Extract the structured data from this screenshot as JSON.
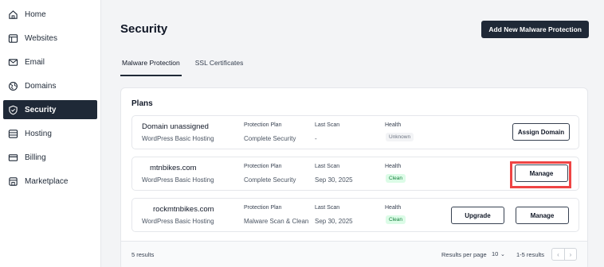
{
  "sidebar": {
    "items": [
      {
        "label": "Home",
        "icon": "home-icon"
      },
      {
        "label": "Websites",
        "icon": "browser-icon"
      },
      {
        "label": "Email",
        "icon": "mail-icon"
      },
      {
        "label": "Domains",
        "icon": "globe-icon"
      },
      {
        "label": "Security",
        "icon": "shield-icon",
        "active": true
      },
      {
        "label": "Hosting",
        "icon": "server-icon"
      },
      {
        "label": "Billing",
        "icon": "credit-card-icon"
      },
      {
        "label": "Marketplace",
        "icon": "store-icon"
      }
    ]
  },
  "header": {
    "title": "Security",
    "add_button": "Add New Malware Protection"
  },
  "tabs": [
    {
      "label": "Malware Protection",
      "active": true
    },
    {
      "label": "SSL Certificates",
      "active": false
    }
  ],
  "plans": {
    "title": "Plans",
    "labels": {
      "plan": "Protection Plan",
      "scan": "Last Scan",
      "health": "Health"
    },
    "rows": [
      {
        "domain": "Domain unassigned",
        "hosting": "WordPress Basic Hosting",
        "plan": "Complete Security",
        "last_scan": "-",
        "health": "Unknown",
        "health_color": "#6b7280",
        "action": "Assign Domain"
      },
      {
        "domain": "mtnbikes.com",
        "hosting": "WordPress Basic Hosting",
        "plan": "Complete Security",
        "last_scan": "Sep 30, 2025",
        "health": "Clean",
        "health_color": "#15803d",
        "action": "Manage"
      },
      {
        "domain": "rockmtnbikes.com",
        "hosting": "WordPress Basic Hosting",
        "plan": "Malware Scan & Clean",
        "last_scan": "Sep 30, 2025",
        "health": "Clean",
        "health_color": "#15803d",
        "upgrade": "Upgrade",
        "action": "Manage"
      }
    ]
  },
  "footer": {
    "results": "5 results",
    "rpp_label": "Results per page",
    "rpp_value": "10",
    "range": "1-5 results",
    "prev": "‹",
    "next": "›"
  },
  "colors": {
    "accent": "#1f2937",
    "highlight": "#ef4444",
    "clean": "#15803d"
  }
}
